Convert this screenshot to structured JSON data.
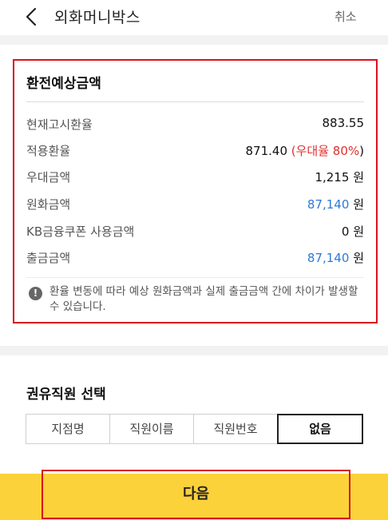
{
  "header": {
    "title": "외화머니박스",
    "cancel_label": "취소"
  },
  "estimate": {
    "title": "환전예상금액",
    "rows": [
      {
        "label": "현재고시환율",
        "value": "883.55",
        "unit": ""
      },
      {
        "label": "적용환율",
        "value": "871.40 ",
        "extra_open": "(",
        "extra_red": "우대율 80%",
        "extra_close": ")",
        "unit": ""
      },
      {
        "label": "우대금액",
        "value": "1,215",
        "unit": "원"
      },
      {
        "label": "원화금액",
        "value": "87,140",
        "unit": "원"
      },
      {
        "label": "KB금융쿠폰 사용금액",
        "value": "0",
        "unit": "원"
      },
      {
        "label": "출금금액",
        "value": "87,140",
        "unit": "원"
      }
    ],
    "notice": "환율 변동에 따라 예상 원화금액과 실제 출금금액 간에 차이가 발생할 수 있습니다."
  },
  "staff": {
    "title": "권유직원 선택",
    "options": [
      "지점명",
      "직원이름",
      "직원번호",
      "없음"
    ],
    "selected": "없음"
  },
  "next_label": "다음",
  "colors": {
    "accent_yellow": "#fcd23a",
    "highlight_red": "#d8141c",
    "link_blue": "#2c7ad6",
    "rate_red": "#e0302f"
  }
}
